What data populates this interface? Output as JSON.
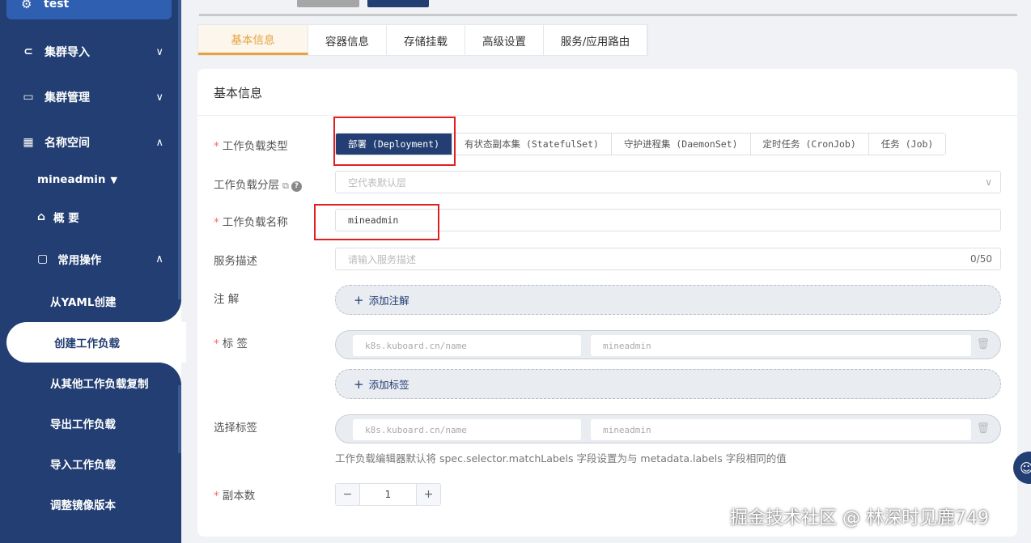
{
  "sidebar": {
    "top_item": "test",
    "menu": [
      {
        "label": "集群导入",
        "icon": "link-icon"
      },
      {
        "label": "集群管理",
        "icon": "box-icon"
      },
      {
        "label": "名称空间",
        "icon": "grid-icon"
      }
    ],
    "namespace": "mineadmin",
    "overview": "概 要",
    "common_ops": "常用操作",
    "sub_items": [
      "从YAML创建",
      "创建工作负载",
      "从其他工作负载复制",
      "导出工作负载",
      "导入工作负载",
      "调整镜像版本"
    ]
  },
  "tabs": [
    "基本信息",
    "容器信息",
    "存储挂载",
    "高级设置",
    "服务/应用路由"
  ],
  "form": {
    "title": "基本信息",
    "workload_type_label": "工作负载类型",
    "workload_types": [
      "部署 (Deployment)",
      "有状态副本集 (StatefulSet)",
      "守护进程集 (DaemonSet)",
      "定时任务 (CronJob)",
      "任务 (Job)"
    ],
    "workload_layer_label": "工作负载分层",
    "workload_layer_placeholder": "空代表默认层",
    "workload_name_label": "工作负载名称",
    "workload_name_value": "mineadmin",
    "service_desc_label": "服务描述",
    "service_desc_placeholder": "请输入服务描述",
    "service_desc_count": "0/50",
    "annotation_label": "注 解",
    "add_annotation": "添加注解",
    "labels_label": "标 签",
    "label_key": "k8s.kuboard.cn/name",
    "label_value": "mineadmin",
    "add_label": "添加标签",
    "selector_label": "选择标签",
    "selector_key": "k8s.kuboard.cn/name",
    "selector_value": "mineadmin",
    "selector_hint": "工作负载编辑器默认将 spec.selector.matchLabels 字段设置为与 metadata.labels 字段相同的值",
    "replicas_label": "副本数",
    "replicas_value": "1"
  },
  "watermark": "掘金技术社区 @ 林深时见鹿749",
  "colors": {
    "primary": "#223e72",
    "accent": "#e6a23c",
    "required": "#f56c6c",
    "highlight_box": "#e02020"
  }
}
